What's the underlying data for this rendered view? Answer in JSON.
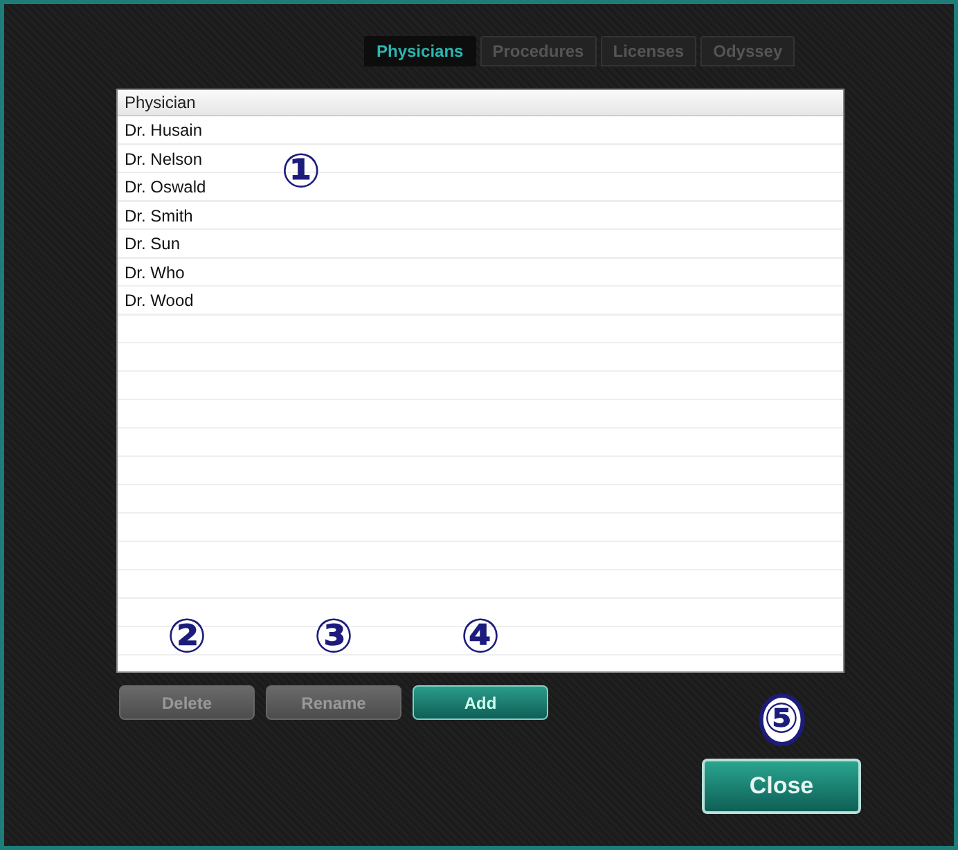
{
  "tabs": [
    {
      "label": "Physicians",
      "selected": true
    },
    {
      "label": "Procedures",
      "selected": false
    },
    {
      "label": "Licenses",
      "selected": false
    },
    {
      "label": "Odyssey",
      "selected": false
    }
  ],
  "list": {
    "header": "Physician",
    "callout": {
      "text": "①",
      "inverted": false
    },
    "rows": [
      "Dr. Husain",
      "Dr. Nelson",
      "Dr. Oswald",
      "Dr. Smith",
      "Dr. Sun",
      "Dr. Who",
      "Dr. Wood"
    ]
  },
  "buttons": [
    {
      "label": "Delete",
      "disabled": true,
      "callout": {
        "text": "②",
        "inverted": false
      }
    },
    {
      "label": "Rename",
      "disabled": true,
      "callout": {
        "text": "③",
        "inverted": false
      }
    },
    {
      "label": "Add",
      "disabled": false,
      "callout": {
        "text": "④",
        "inverted": false
      }
    }
  ],
  "close_button": {
    "label": "Close",
    "disabled": false,
    "callout": {
      "text": "⑤",
      "inverted": true
    }
  }
}
